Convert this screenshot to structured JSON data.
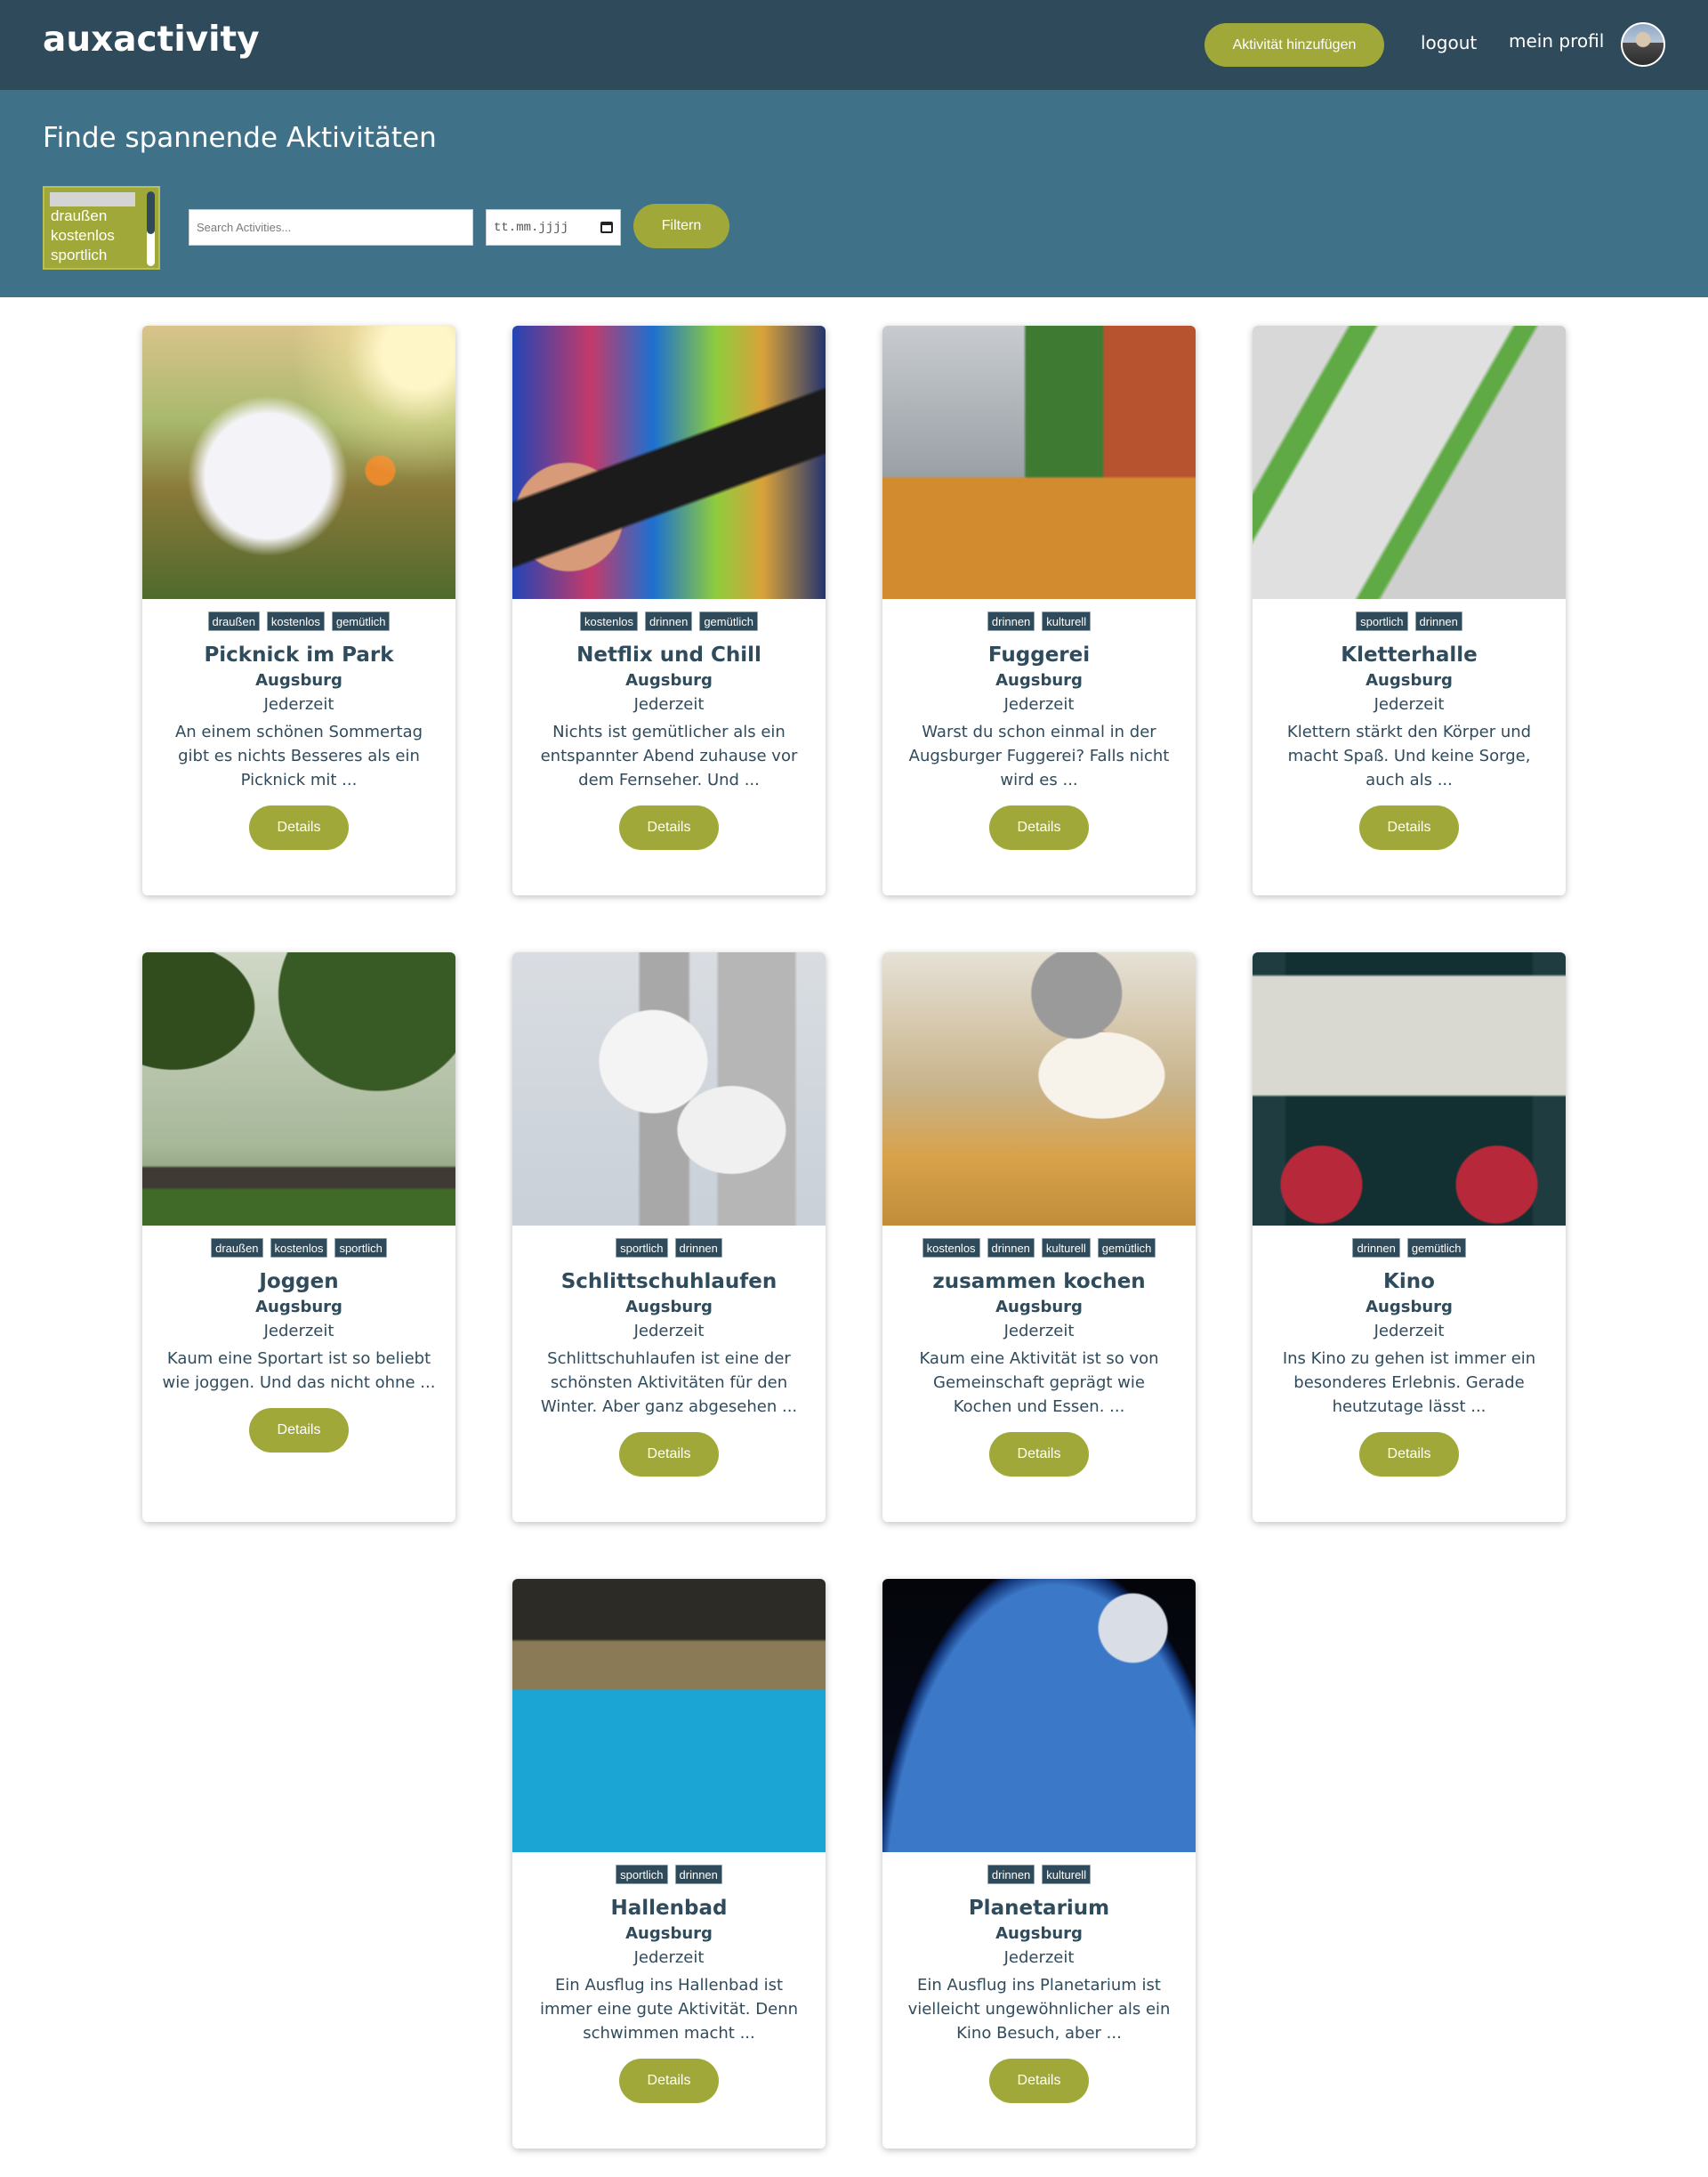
{
  "header": {
    "brand": "auxactivity",
    "add_activity_label": "Aktivität hinzufügen",
    "logout_label": "logout",
    "profile_label": "mein profil"
  },
  "filter": {
    "headline": "Finde spannende Aktivitäten",
    "tag_options": [
      "draußen",
      "kostenlos",
      "sportlich"
    ],
    "search_placeholder": "Search Activities...",
    "date_placeholder": "tt.mm.jjjj",
    "filter_label": "Filtern"
  },
  "details_label": "Details",
  "cards": [
    {
      "title": "Picknick im Park",
      "city": "Augsburg",
      "when": "Jederzeit",
      "tags": [
        "draußen",
        "kostenlos",
        "gemütlich"
      ],
      "desc": "An einem schönen Sommertag gibt es nichts Besseres als ein Picknick mit ...",
      "image": "picnic-image"
    },
    {
      "title": "Netflix und Chill",
      "city": "Augsburg",
      "when": "Jederzeit",
      "tags": [
        "kostenlos",
        "drinnen",
        "gemütlich"
      ],
      "desc": "Nichts ist gemütlicher als ein entspannter Abend zuhause vor dem Fernseher. Und ...",
      "image": "tv-remote-image"
    },
    {
      "title": "Fuggerei",
      "city": "Augsburg",
      "when": "Jederzeit",
      "tags": [
        "drinnen",
        "kulturell"
      ],
      "desc": "Warst du schon einmal in der Augsburger Fuggerei? Falls nicht wird es ...",
      "image": "fuggerei-image"
    },
    {
      "title": "Kletterhalle",
      "city": "Augsburg",
      "when": "Jederzeit",
      "tags": [
        "sportlich",
        "drinnen"
      ],
      "desc": "Klettern stärkt den Körper und macht Spaß. Und keine Sorge, auch als ...",
      "image": "climbing-wall-image"
    },
    {
      "title": "Joggen",
      "city": "Augsburg",
      "when": "Jederzeit",
      "tags": [
        "draußen",
        "kostenlos",
        "sportlich"
      ],
      "desc": "Kaum eine Sportart ist so beliebt wie joggen. Und das nicht ohne ...",
      "image": "park-jogging-image"
    },
    {
      "title": "Schlittschuhlaufen",
      "city": "Augsburg",
      "when": "Jederzeit",
      "tags": [
        "sportlich",
        "drinnen"
      ],
      "desc": "Schlittschuhlaufen ist eine der schönsten Aktivitäten für den Winter. Aber ganz abgesehen ...",
      "image": "ice-skates-image"
    },
    {
      "title": "zusammen kochen",
      "city": "Augsburg",
      "when": "Jederzeit",
      "tags": [
        "kostenlos",
        "drinnen",
        "kulturell",
        "gemütlich"
      ],
      "desc": "Kaum eine Aktivität ist so von Gemeinschaft geprägt wie Kochen und Essen. ...",
      "image": "cooking-image"
    },
    {
      "title": "Kino",
      "city": "Augsburg",
      "when": "Jederzeit",
      "tags": [
        "drinnen",
        "gemütlich"
      ],
      "desc": "Ins Kino zu gehen ist immer ein besonderes Erlebnis. Gerade heutzutage lässt ...",
      "image": "cinema-image"
    },
    {
      "title": "Hallenbad",
      "city": "Augsburg",
      "when": "Jederzeit",
      "tags": [
        "sportlich",
        "drinnen"
      ],
      "desc": "Ein Ausflug ins Hallenbad ist immer eine gute Aktivität. Denn schwimmen macht ...",
      "image": "indoor-pool-image"
    },
    {
      "title": "Planetarium",
      "city": "Augsburg",
      "when": "Jederzeit",
      "tags": [
        "drinnen",
        "kulturell"
      ],
      "desc": "Ein Ausflug ins Planetarium ist vielleicht ungewöhnlicher als ein Kino Besuch, aber ...",
      "image": "astronaut-earth-image"
    }
  ],
  "colors": {
    "navbar": "#2f4a5a",
    "filterbar": "#3f7289",
    "accent": "#a1a83a",
    "text": "#2f4b5c"
  },
  "icons": {
    "calendar": "calendar-icon",
    "avatar": "avatar"
  }
}
